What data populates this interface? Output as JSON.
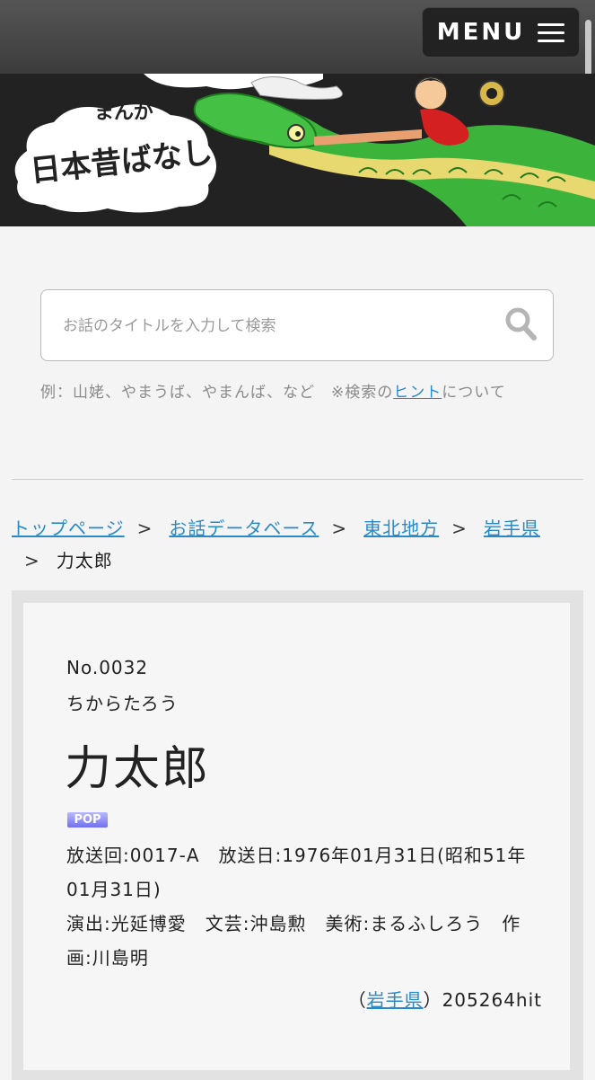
{
  "header": {
    "menu_label": "MENU"
  },
  "banner": {
    "logo_text_top": "まんが",
    "logo_text_main": "日本昔ばなし"
  },
  "search": {
    "placeholder": "お話のタイトルを入力して検索",
    "value": "",
    "hint_prefix": "例：山姥、やまうば、やまんば、など　※検索の",
    "hint_link": "ヒント",
    "hint_suffix": "について"
  },
  "breadcrumb": {
    "items": [
      "トップページ",
      "お話データベース",
      "東北地方",
      "岩手県"
    ],
    "separator": ">",
    "current": "力太郎"
  },
  "story": {
    "number": "No.0032",
    "reading": "ちからたろう",
    "title": "力太郎",
    "badge": "POP",
    "broadcast": "放送回:0017-A　放送日:1976年01月31日(昭和51年01月31日)",
    "credits": "演出:光延博愛　文芸:沖島勲　美術:まるふしろう　作画:川島明",
    "region_open": "（",
    "region": "岩手県",
    "region_close": "）",
    "hits": "205264hit"
  },
  "colors": {
    "link": "#2a8ac8",
    "header_bg": "#444444",
    "dragon": "#3cb43c"
  }
}
